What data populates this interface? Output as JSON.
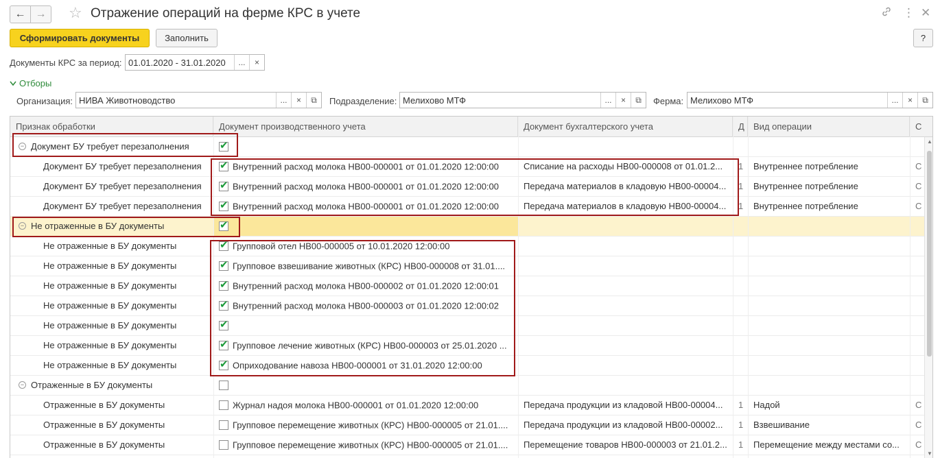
{
  "window": {
    "title": "Отражение операций на ферме КРС в учете",
    "back_icon": "←",
    "forward_icon": "→",
    "favorite_icon": "☆",
    "link_icon": "🔗",
    "menu_icon": "⋮",
    "close_icon": "✕"
  },
  "toolbar": {
    "generate_label": "Сформировать документы",
    "fill_label": "Заполнить",
    "help_label": "?"
  },
  "period": {
    "label": "Документы КРС за период:",
    "value": "01.01.2020 - 31.01.2020",
    "select_btn": "...",
    "clear_btn": "×"
  },
  "filters": {
    "toggle_label": "Отборы",
    "organization": {
      "label": "Организация:",
      "value": "НИВА Животноводство"
    },
    "division": {
      "label": "Подразделение:",
      "value": "Мелихово МТФ"
    },
    "farm": {
      "label": "Ферма:",
      "value": "Мелихово МТФ"
    },
    "select_btn": "...",
    "clear_btn": "×",
    "open_btn": "⧉"
  },
  "grid": {
    "columns": [
      "Признак обработки",
      "Документ производственного учета",
      "Документ бухгалтерского учета",
      "Д",
      "Вид операции",
      "С"
    ],
    "rows": [
      {
        "type": "group",
        "sign": "Документ БУ требует перезаполнения",
        "checked": true,
        "doc": "",
        "acc": "",
        "flag": "",
        "op": "",
        "last": ""
      },
      {
        "type": "child",
        "sign": "Документ БУ требует перезаполнения",
        "checked": true,
        "doc": "Внутренний расход молока НВ00-000001 от 01.01.2020 12:00:00",
        "acc": "Списание на расходы НВ00-000008 от 01.01.2...",
        "flag": "1",
        "op": "Внутреннее потребление",
        "last": "С"
      },
      {
        "type": "child",
        "sign": "Документ БУ требует перезаполнения",
        "checked": true,
        "doc": "Внутренний расход молока НВ00-000001 от 01.01.2020 12:00:00",
        "acc": "Передача материалов в кладовую НВ00-00004...",
        "flag": "1",
        "op": "Внутреннее потребление",
        "last": "С"
      },
      {
        "type": "child",
        "sign": "Документ БУ требует перезаполнения",
        "checked": true,
        "doc": "Внутренний расход молока НВ00-000001 от 01.01.2020 12:00:00",
        "acc": "Передача материалов в кладовую НВ00-00004...",
        "flag": "1",
        "op": "Внутреннее потребление",
        "last": "С"
      },
      {
        "type": "group",
        "sign": "Не отраженные в БУ документы",
        "checked": true,
        "selected": true,
        "doc": "",
        "acc": "",
        "flag": "",
        "op": "",
        "last": ""
      },
      {
        "type": "child",
        "sign": "Не отраженные в БУ документы",
        "checked": true,
        "doc": "Групповой отел НВ00-000005 от 10.01.2020 12:00:00",
        "acc": "",
        "flag": "",
        "op": "",
        "last": ""
      },
      {
        "type": "child",
        "sign": "Не отраженные в БУ документы",
        "checked": true,
        "doc": "Групповое взвешивание животных (КРС) НВ00-000008 от 31.01....",
        "acc": "",
        "flag": "",
        "op": "",
        "last": ""
      },
      {
        "type": "child",
        "sign": "Не отраженные в БУ документы",
        "checked": true,
        "doc": "Внутренний расход молока НВ00-000002 от 01.01.2020 12:00:01",
        "acc": "",
        "flag": "",
        "op": "",
        "last": ""
      },
      {
        "type": "child",
        "sign": "Не отраженные в БУ документы",
        "checked": true,
        "doc": "Внутренний расход молока НВ00-000003 от 01.01.2020 12:00:02",
        "acc": "",
        "flag": "",
        "op": "",
        "last": ""
      },
      {
        "type": "child",
        "sign": "Не отраженные в БУ документы",
        "checked": true,
        "doc": "",
        "acc": "",
        "flag": "",
        "op": "",
        "last": ""
      },
      {
        "type": "child",
        "sign": "Не отраженные в БУ документы",
        "checked": true,
        "doc": "Групповое лечение животных (КРС) НВ00-000003 от 25.01.2020 ...",
        "acc": "",
        "flag": "",
        "op": "",
        "last": ""
      },
      {
        "type": "child",
        "sign": "Не отраженные в БУ документы",
        "checked": true,
        "doc": "Оприходование навоза НВ00-000001 от 31.01.2020 12:00:00",
        "acc": "",
        "flag": "",
        "op": "",
        "last": ""
      },
      {
        "type": "group",
        "sign": "Отраженные в БУ документы",
        "checked": false,
        "doc": "",
        "acc": "",
        "flag": "",
        "op": "",
        "last": ""
      },
      {
        "type": "child",
        "sign": "Отраженные в БУ документы",
        "checked": false,
        "doc": "Журнал надоя молока НВ00-000001 от 01.01.2020 12:00:00",
        "acc": "Передача продукции из кладовой НВ00-00004...",
        "flag": "1",
        "op": "Надой",
        "last": "С"
      },
      {
        "type": "child",
        "sign": "Отраженные в БУ документы",
        "checked": false,
        "doc": "Групповое перемещение животных (КРС) НВ00-000005 от 21.01....",
        "acc": "Передача продукции из кладовой НВ00-00002...",
        "flag": "1",
        "op": "Взвешивание",
        "last": "С"
      },
      {
        "type": "child",
        "sign": "Отраженные в БУ документы",
        "checked": false,
        "doc": "Групповое перемещение животных (КРС) НВ00-000005 от 21.01....",
        "acc": "Перемещение товаров НВ00-000003 от 21.01.2...",
        "flag": "1",
        "op": "Перемещение между местами со...",
        "last": "С"
      }
    ]
  }
}
